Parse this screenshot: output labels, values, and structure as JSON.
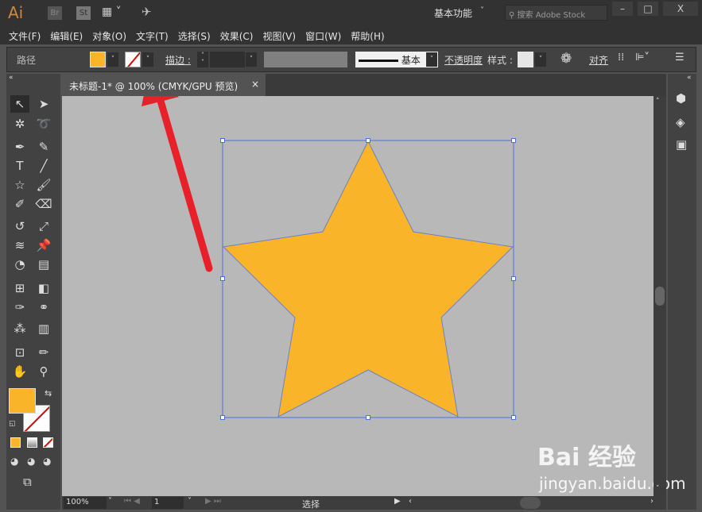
{
  "app": {
    "logo": "Ai",
    "br": "Br",
    "st": "St",
    "workspace": "基本功能",
    "search_placeholder": "搜索 Adobe Stock",
    "minimize": "–",
    "maximize": "□",
    "close": "X"
  },
  "menu": [
    "文件(F)",
    "编辑(E)",
    "对象(O)",
    "文字(T)",
    "选择(S)",
    "效果(C)",
    "视图(V)",
    "窗口(W)",
    "帮助(H)"
  ],
  "control": {
    "selection": "路径",
    "fill_color": "#f9b42a",
    "stroke_label": "描边",
    "stroke_weight": "",
    "brush": "基本",
    "opacity_label": "不透明度",
    "style_label": "样式",
    "align_label": "对齐"
  },
  "document": {
    "tab_title": "未标题-1* @ 100% (CMYK/GPU 预览)",
    "close": "×"
  },
  "status": {
    "zoom": "100%",
    "page": "1",
    "tool": "选择"
  },
  "colors": {
    "star_fill": "#f9b42a",
    "selection": "#4a6fe0",
    "arrow": "#e8202a"
  },
  "watermark": {
    "brand": "Bai 经验",
    "url": "jingyan.baidu.com"
  }
}
